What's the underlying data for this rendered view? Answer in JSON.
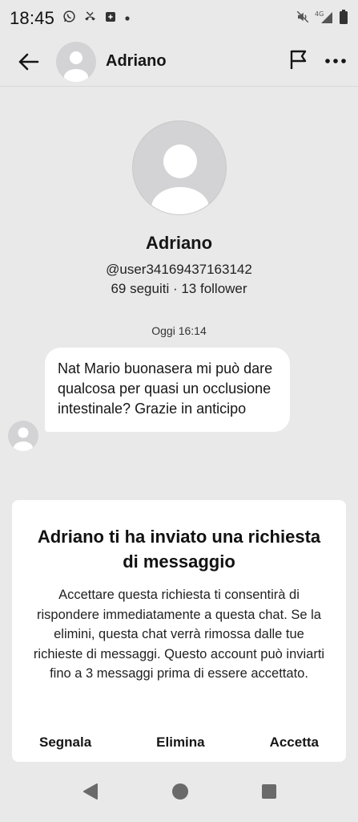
{
  "status_bar": {
    "time": "18:45",
    "network_label": "4G"
  },
  "header": {
    "name": "Adriano"
  },
  "profile": {
    "name": "Adriano",
    "handle": "@user34169437163142",
    "stats": "69 seguiti · 13 follower"
  },
  "conversation": {
    "timestamp": "Oggi 16:14",
    "messages": [
      {
        "text": "Nat Mario buonasera mi può dare qualcosa per quasi un occlusione intestinale? Grazie in anticipo"
      }
    ]
  },
  "request": {
    "title": "Adriano ti ha inviato una richiesta di messaggio",
    "body": "Accettare questa richiesta ti consentirà di rispondere immediatamente a questa chat. Se la elimini, questa chat verrà rimossa dalle tue richieste di messaggi. Questo account può inviarti fino a 3 messaggi prima di essere accettato.",
    "report_label": "Segnala",
    "delete_label": "Elimina",
    "accept_label": "Accetta"
  }
}
